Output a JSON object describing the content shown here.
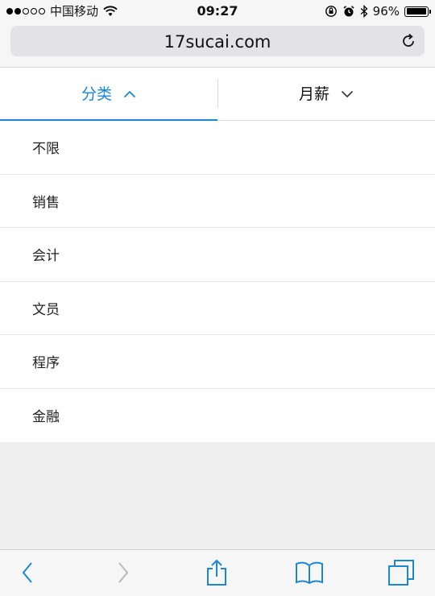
{
  "status_bar": {
    "carrier": "中国移动",
    "time": "09:27",
    "battery": "96%",
    "battery_level": 0.96,
    "signal_bars_filled": 2,
    "signal_bars_total": 5
  },
  "browser": {
    "url": "17sucai.com"
  },
  "tabs": [
    {
      "label": "分类",
      "active": true,
      "chevron": "chevron-up-icon"
    },
    {
      "label": "月薪",
      "active": false,
      "chevron": "chevron-down-icon"
    }
  ],
  "categories": [
    "不限",
    "销售",
    "会计",
    "文员",
    "程序",
    "金融"
  ],
  "colors": {
    "accent": "#1b87d3",
    "toolbar_icon": "#1b87d3",
    "disabled_icon": "#b8b8bd"
  }
}
